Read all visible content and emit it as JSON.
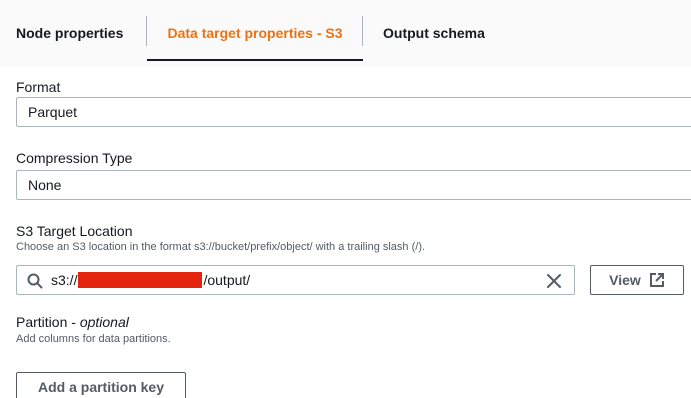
{
  "tabs": [
    {
      "label": "Node properties",
      "active": false
    },
    {
      "label": "Data target properties - S3",
      "active": true
    },
    {
      "label": "Output schema",
      "active": false
    }
  ],
  "format": {
    "label": "Format",
    "value": "Parquet"
  },
  "compression": {
    "label": "Compression Type",
    "value": "None"
  },
  "s3_target": {
    "label": "S3 Target Location",
    "description": "Choose an S3 location in the format s3://bucket/prefix/object/ with a trailing slash (/).",
    "value_prefix": "s3://",
    "value_suffix": "/output/",
    "view_label": "View"
  },
  "partition": {
    "label": "Partition - ",
    "label_optional": "optional",
    "description": "Add columns for data partitions.",
    "add_button": "Add a partition key"
  },
  "colors": {
    "accent": "#ec7211",
    "text": "#16191f",
    "border": "#aab7b8",
    "redaction": "#e4240f"
  },
  "icons": {
    "search": "search-icon",
    "clear": "close-icon",
    "external": "external-link-icon"
  }
}
